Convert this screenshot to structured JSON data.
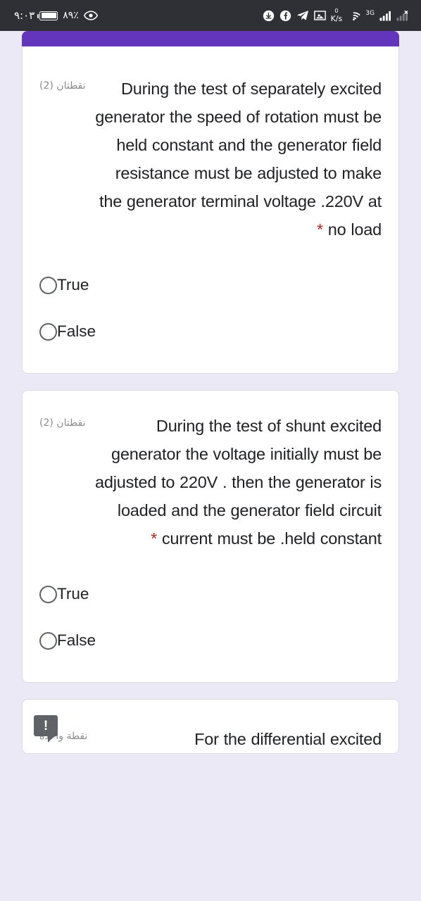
{
  "status_bar": {
    "time": "٩:٠٣",
    "battery_percent": "٨٩٪",
    "network_speed_value": "0",
    "network_speed_unit": "K/s",
    "signal_label_3g": "3G",
    "icons": [
      "eye-icon",
      "battery-icon",
      "download-circle-icon",
      "facebook-icon",
      "telegram-icon",
      "photo-icon",
      "wifi-icon",
      "cellular-signal-icon",
      "cellular-signal-off-icon"
    ],
    "background_color": "#2e3035"
  },
  "theme": {
    "header_accent": "#6335bd",
    "page_background": "#ece9f7",
    "card_background": "#ffffff",
    "required_star_color": "#b3261e",
    "muted_text": "#8b8b90",
    "body_text": "#202124"
  },
  "questions": [
    {
      "points_label": "نقطتان (2)",
      "text": "During the test of separately excited generator the speed of rotation must be held constant and the generator field resistance must be adjusted to make the generator terminal voltage .220V at no load",
      "required_marker": "*",
      "options": [
        {
          "label": "True",
          "selected": false
        },
        {
          "label": "False",
          "selected": false
        }
      ]
    },
    {
      "points_label": "نقطتان (2)",
      "text": "During the test of shunt excited generator the voltage initially must be adjusted to 220V . then the generator is loaded and the generator field circuit current must be .held constant",
      "required_marker": "*",
      "options": [
        {
          "label": "True",
          "selected": false
        },
        {
          "label": "False",
          "selected": false
        }
      ]
    },
    {
      "points_label": "نقطة واحدة",
      "text": "For the differential excited",
      "badge": "!",
      "options": []
    }
  ]
}
